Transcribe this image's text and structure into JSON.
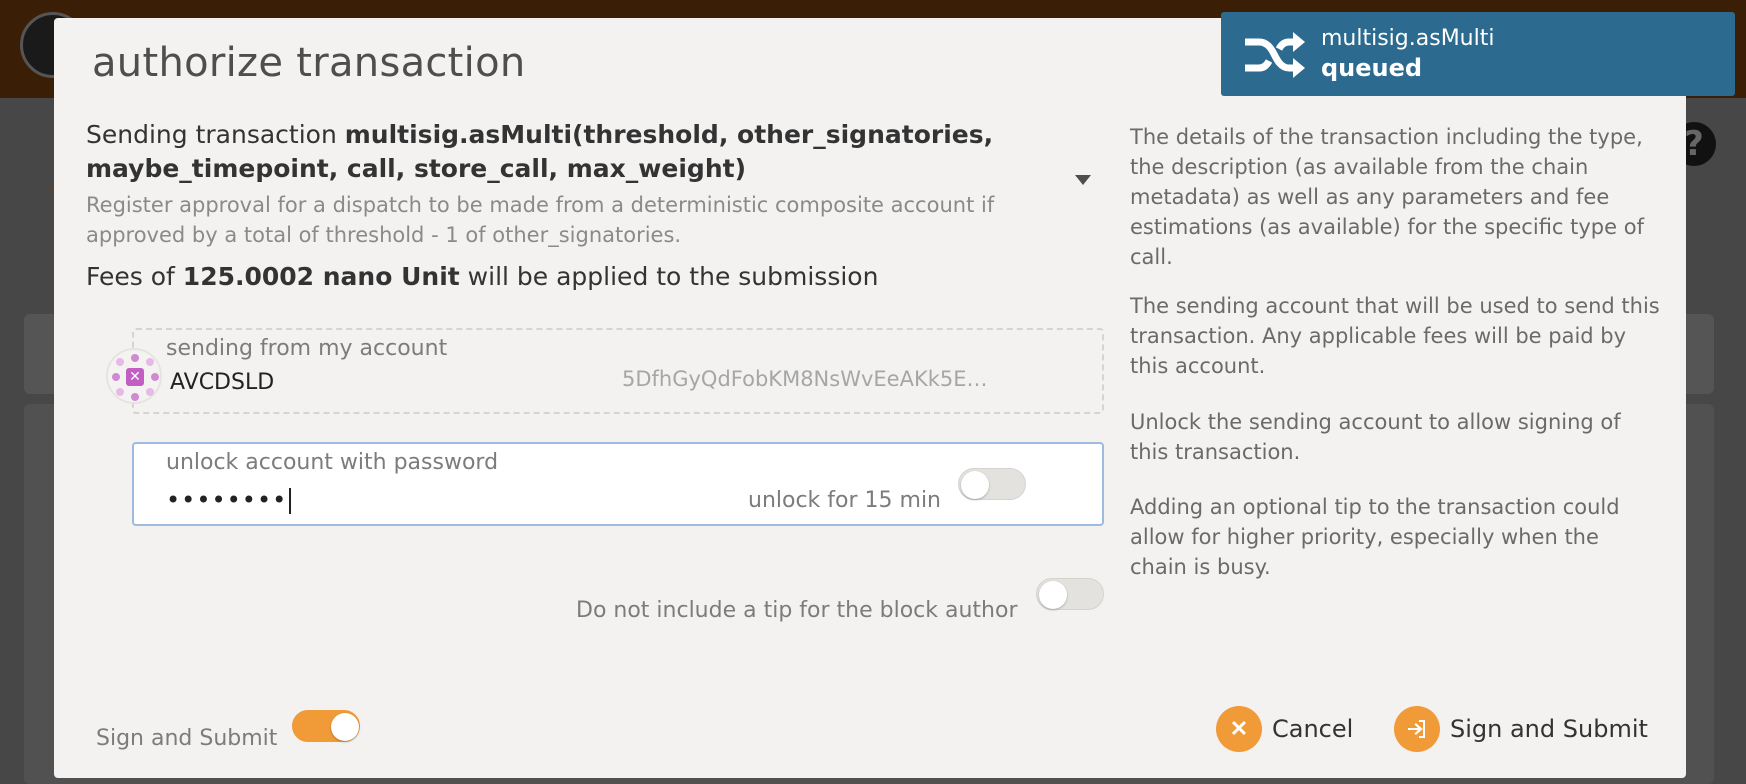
{
  "modal": {
    "title": "authorize transaction",
    "tx_prefix": "Sending transaction ",
    "tx_call": "multisig.asMulti(threshold, other_signatories, maybe_timepoint, call, store_call, max_weight)",
    "tx_description": "Register approval for a dispatch to be made from a deterministic composite account if approved by a total of threshold - 1 of other_signatories.",
    "fees_prefix": "Fees of ",
    "fees_amount": "125.0002 nano Unit",
    "fees_suffix": " will be applied to the submission"
  },
  "help": {
    "details": "The details of the transaction including the type, the description (as available from the chain metadata) as well as any parameters and fee estimations (as available) for the specific type of call.",
    "account": "The sending account that will be used to send this transaction. Any applicable fees will be paid by this account.",
    "unlock": "Unlock the sending account to allow signing of this transaction.",
    "tip": "Adding an optional tip to the transaction could allow for higher priority, especially when the chain is busy."
  },
  "account": {
    "label": "sending from my account",
    "name": "AVCDSLD",
    "address": "5DfhGyQdFobKM8NsWvEeAKk5EQQg…"
  },
  "password": {
    "label": "unlock account with password",
    "value": "••••••••",
    "unlock_label": "unlock for 15 min",
    "unlock_on": false
  },
  "tip": {
    "label": "Do not include a tip for the block author",
    "on": false
  },
  "footer": {
    "sign_toggle_label": "Sign and Submit",
    "sign_toggle_on": true,
    "cancel_label": "Cancel",
    "cancel_icon": "close-icon",
    "submit_label": "Sign and Submit",
    "submit_icon": "sign-in-icon"
  },
  "toast": {
    "method": "multisig.asMulti",
    "status": "queued",
    "icon": "shuffle-icon",
    "color": "#2c6b8f"
  },
  "colors": {
    "accent": "#f09a38",
    "input_border": "#9dbbe0"
  }
}
